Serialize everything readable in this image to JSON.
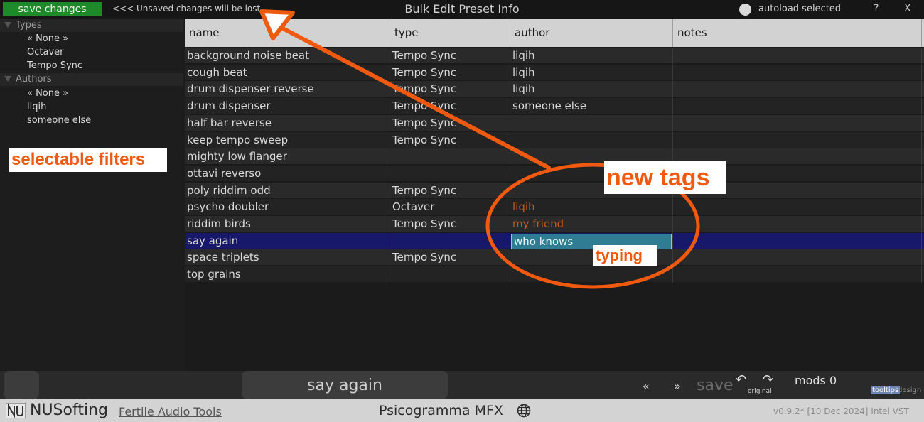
{
  "topbar": {
    "save_label": "save changes",
    "unsaved_warning": "<<< Unsaved changes will be lost",
    "title": "Bulk Edit Preset Info",
    "autoload_label": "autoload selected",
    "help_label": "?",
    "close_label": "X"
  },
  "sidebar": {
    "types_header": "Types",
    "types": [
      "« None »",
      "Octaver",
      "Tempo Sync"
    ],
    "authors_header": "Authors",
    "authors": [
      "« None »",
      "liqih",
      "someone else"
    ]
  },
  "table": {
    "columns": [
      "name",
      "type",
      "author",
      "notes"
    ],
    "rows": [
      {
        "name": "background noise beat",
        "type": "Tempo Sync",
        "author": "liqih",
        "notes": ""
      },
      {
        "name": "cough beat",
        "type": "Tempo Sync",
        "author": "liqih",
        "notes": ""
      },
      {
        "name": "drum dispenser reverse",
        "type": "Tempo Sync",
        "author": "liqih",
        "notes": ""
      },
      {
        "name": "drum dispenser",
        "type": "Tempo Sync",
        "author": "someone else",
        "notes": ""
      },
      {
        "name": "half bar reverse",
        "type": "Tempo Sync",
        "author": "",
        "notes": ""
      },
      {
        "name": "keep tempo sweep",
        "type": "Tempo Sync",
        "author": "",
        "notes": ""
      },
      {
        "name": "mighty low flanger",
        "type": "",
        "author": "",
        "notes": ""
      },
      {
        "name": "ottavi reverso",
        "type": "",
        "author": "",
        "notes": ""
      },
      {
        "name": "poly riddim odd",
        "type": "Tempo Sync",
        "author": "",
        "notes": ""
      },
      {
        "name": "psycho doubler",
        "type": "Octaver",
        "author": "liqih",
        "notes": ""
      },
      {
        "name": "riddim birds",
        "type": "Tempo Sync",
        "author": "my friend",
        "notes": ""
      },
      {
        "name": "say again",
        "type": "",
        "author": "who knows",
        "notes": ""
      },
      {
        "name": "space triplets",
        "type": "Tempo Sync",
        "author": "",
        "notes": ""
      },
      {
        "name": "top grains",
        "type": "",
        "author": "",
        "notes": ""
      }
    ]
  },
  "annotations": {
    "filters": "selectable filters",
    "new_tags": "new tags",
    "typing": "typing"
  },
  "bottom": {
    "preset_name": "say again",
    "prev_label": "«",
    "next_label": "»",
    "save_label": "save",
    "undo_label": "↶",
    "redo_label": "↷",
    "original_label": "original",
    "mods_label": "mods 0",
    "tooltips_label": "tooltips",
    "design_label": "design"
  },
  "footer": {
    "brand": "NUSofting",
    "brand_sub": "Fertile Audio Tools",
    "product": "Psicogramma MFX",
    "version": "v0.9.2* [10 Dec 2024] Intel VST"
  },
  "colors": {
    "accent_green": "#1f8a2a",
    "annotation_orange": "#f05a10",
    "selected_row": "#18186a",
    "edit_field": "#2f7d92"
  }
}
